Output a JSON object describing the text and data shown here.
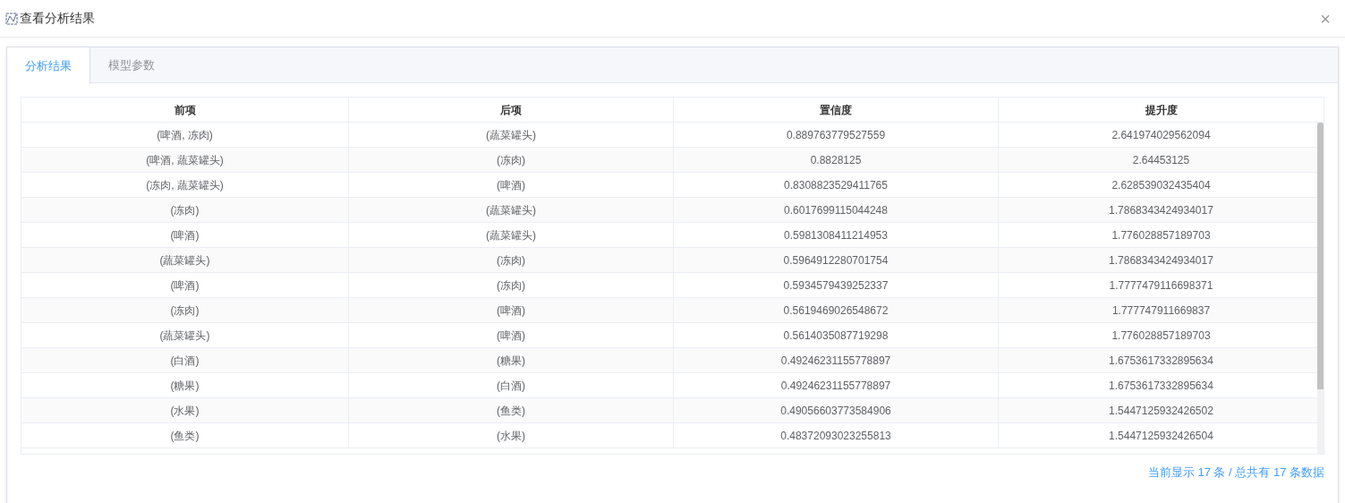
{
  "window": {
    "title": "查看分析结果",
    "close": "×"
  },
  "tabs": [
    {
      "label": "分析结果",
      "selected": true
    },
    {
      "label": "模型参数",
      "selected": false
    }
  ],
  "table": {
    "columns": [
      "前项",
      "后项",
      "置信度",
      "提升度"
    ],
    "rows": [
      [
        "(啤酒, 冻肉)",
        "(蔬菜罐头)",
        "0.889763779527559",
        "2.641974029562094"
      ],
      [
        "(啤酒, 蔬菜罐头)",
        "(冻肉)",
        "0.8828125",
        "2.64453125"
      ],
      [
        "(冻肉, 蔬菜罐头)",
        "(啤酒)",
        "0.8308823529411765",
        "2.628539032435404"
      ],
      [
        "(冻肉)",
        "(蔬菜罐头)",
        "0.6017699115044248",
        "1.7868343424934017"
      ],
      [
        "(啤酒)",
        "(蔬菜罐头)",
        "0.5981308411214953",
        "1.776028857189703"
      ],
      [
        "(蔬菜罐头)",
        "(冻肉)",
        "0.5964912280701754",
        "1.7868343424934017"
      ],
      [
        "(啤酒)",
        "(冻肉)",
        "0.5934579439252337",
        "1.7777479116698371"
      ],
      [
        "(冻肉)",
        "(啤酒)",
        "0.5619469026548672",
        "1.777747911669837"
      ],
      [
        "(蔬菜罐头)",
        "(啤酒)",
        "0.5614035087719298",
        "1.776028857189703"
      ],
      [
        "(白酒)",
        "(糖果)",
        "0.49246231155778897",
        "1.6753617332895634"
      ],
      [
        "(糖果)",
        "(白酒)",
        "0.49246231155778897",
        "1.6753617332895634"
      ],
      [
        "(水果)",
        "(鱼类)",
        "0.49056603773584906",
        "1.5447125932426502"
      ],
      [
        "(鱼类)",
        "(水果)",
        "0.48372093023255813",
        "1.5447125932426504"
      ]
    ]
  },
  "footer": "当前显示 17 条 / 总共有 17 条数据"
}
